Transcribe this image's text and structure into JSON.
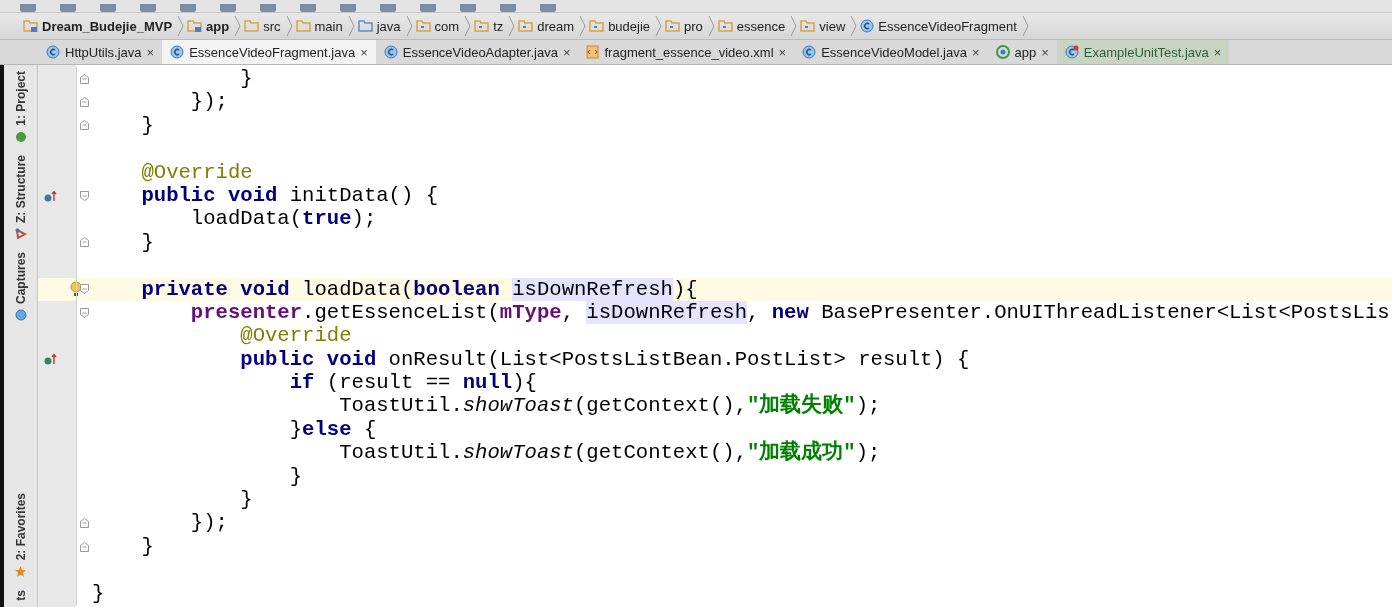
{
  "breadcrumbs": [
    {
      "label": "Dream_Budejie_MVP",
      "kind": "module"
    },
    {
      "label": "app",
      "kind": "module"
    },
    {
      "label": "src",
      "kind": "folder"
    },
    {
      "label": "main",
      "kind": "folder"
    },
    {
      "label": "java",
      "kind": "source"
    },
    {
      "label": "com",
      "kind": "package"
    },
    {
      "label": "tz",
      "kind": "package"
    },
    {
      "label": "dream",
      "kind": "package"
    },
    {
      "label": "budejie",
      "kind": "package"
    },
    {
      "label": "pro",
      "kind": "package"
    },
    {
      "label": "essence",
      "kind": "package"
    },
    {
      "label": "view",
      "kind": "package"
    },
    {
      "label": "EssenceVideoFragment",
      "kind": "class"
    }
  ],
  "tabs": [
    {
      "label": "HttpUtils.java",
      "kind": "class",
      "selected": false,
      "close": "×"
    },
    {
      "label": "EssenceVideoFragment.java",
      "kind": "class",
      "selected": true,
      "close": "×"
    },
    {
      "label": "EssenceVideoAdapter.java",
      "kind": "class",
      "selected": false,
      "close": "×"
    },
    {
      "label": "fragment_essence_video.xml",
      "kind": "xml",
      "selected": false,
      "close": "×"
    },
    {
      "label": "EssenceVideoModel.java",
      "kind": "class",
      "selected": false,
      "close": "×"
    },
    {
      "label": "app",
      "kind": "module",
      "selected": false,
      "close": "×"
    },
    {
      "label": "ExampleUnitTest.java",
      "kind": "test",
      "selected": false,
      "close": "×"
    }
  ],
  "tool_windows": [
    {
      "label": "1: Project",
      "kind": "project"
    },
    {
      "label": "Z: Structure",
      "kind": "structure"
    },
    {
      "label": "Captures",
      "kind": "captures"
    },
    {
      "label": "2: Favorites",
      "kind": "favorites"
    },
    {
      "label": "ts",
      "kind": "none"
    }
  ],
  "editor": {
    "lines": [
      {
        "kind": "code",
        "fold": {
          "kind": "end"
        },
        "segments": [
          {
            "kind": "plain",
            "text": "            }"
          }
        ]
      },
      {
        "kind": "code",
        "fold": {
          "kind": "end"
        },
        "segments": [
          {
            "kind": "plain",
            "text": "        });"
          }
        ]
      },
      {
        "kind": "code",
        "fold": {
          "kind": "end"
        },
        "segments": [
          {
            "kind": "plain",
            "text": "    }"
          }
        ]
      },
      {
        "kind": "blank"
      },
      {
        "kind": "code",
        "segments": [
          {
            "kind": "annotation",
            "text": "    @Override"
          }
        ]
      },
      {
        "kind": "code",
        "fold": {
          "kind": "start"
        },
        "gutter": {
          "kind": "overrides"
        },
        "segments": [
          {
            "kind": "keyword",
            "text": "    public void "
          },
          {
            "kind": "plain",
            "text": "initData() {"
          }
        ]
      },
      {
        "kind": "code",
        "segments": [
          {
            "kind": "plain",
            "text": "        loadData("
          },
          {
            "kind": "keyword",
            "text": "true"
          },
          {
            "kind": "plain",
            "text": ");"
          }
        ]
      },
      {
        "kind": "code",
        "fold": {
          "kind": "end"
        },
        "segments": [
          {
            "kind": "plain",
            "text": "    }"
          }
        ]
      },
      {
        "kind": "blank"
      },
      {
        "kind": "code",
        "fold": {
          "kind": "start"
        },
        "gutter": {
          "kind": "bulb"
        },
        "current": true,
        "segments": [
          {
            "kind": "keyword",
            "text": "    private void "
          },
          {
            "kind": "plain",
            "text": "loadData("
          },
          {
            "kind": "keyword",
            "text": "boolean "
          },
          {
            "kind": "param",
            "text": "isDownRefresh"
          },
          {
            "kind": "plain",
            "text": "){"
          }
        ]
      },
      {
        "kind": "code",
        "fold": {
          "kind": "start"
        },
        "segments": [
          {
            "kind": "field",
            "text": "        presenter"
          },
          {
            "kind": "plain",
            "text": ".getEssenceList("
          },
          {
            "kind": "field",
            "text": "mType"
          },
          {
            "kind": "plain",
            "text": ", "
          },
          {
            "kind": "param",
            "text": "isDownRefresh"
          },
          {
            "kind": "plain",
            "text": ", "
          },
          {
            "kind": "keyword",
            "text": "new "
          },
          {
            "kind": "plain",
            "text": "BasePresenter.OnUIThreadListener<List<PostsLis"
          }
        ]
      },
      {
        "kind": "code",
        "segments": [
          {
            "kind": "annotation",
            "text": "            @Override"
          }
        ]
      },
      {
        "kind": "code",
        "gutter": {
          "kind": "implements"
        },
        "segments": [
          {
            "kind": "keyword",
            "text": "            public void "
          },
          {
            "kind": "plain",
            "text": "onResult(List<PostsListBean.PostList> result) {"
          }
        ]
      },
      {
        "kind": "code",
        "segments": [
          {
            "kind": "keyword",
            "text": "                if "
          },
          {
            "kind": "plain",
            "text": "(result == "
          },
          {
            "kind": "keyword",
            "text": "null"
          },
          {
            "kind": "plain",
            "text": "){"
          }
        ]
      },
      {
        "kind": "code",
        "segments": [
          {
            "kind": "plain",
            "text": "                    ToastUtil."
          },
          {
            "kind": "static",
            "text": "showToast"
          },
          {
            "kind": "plain",
            "text": "(getContext(),"
          },
          {
            "kind": "string",
            "text": "\"加载失败\""
          },
          {
            "kind": "plain",
            "text": ");"
          }
        ]
      },
      {
        "kind": "code",
        "segments": [
          {
            "kind": "plain",
            "text": "                }"
          },
          {
            "kind": "keyword",
            "text": "else "
          },
          {
            "kind": "plain",
            "text": "{"
          }
        ]
      },
      {
        "kind": "code",
        "segments": [
          {
            "kind": "plain",
            "text": "                    ToastUtil."
          },
          {
            "kind": "static",
            "text": "showToast"
          },
          {
            "kind": "plain",
            "text": "(getContext(),"
          },
          {
            "kind": "string",
            "text": "\"加载成功\""
          },
          {
            "kind": "plain",
            "text": ");"
          }
        ]
      },
      {
        "kind": "code",
        "segments": [
          {
            "kind": "plain",
            "text": "                }"
          }
        ]
      },
      {
        "kind": "code",
        "segments": [
          {
            "kind": "plain",
            "text": "            }"
          }
        ]
      },
      {
        "kind": "code",
        "fold": {
          "kind": "end"
        },
        "segments": [
          {
            "kind": "plain",
            "text": "        });"
          }
        ]
      },
      {
        "kind": "code",
        "fold": {
          "kind": "end"
        },
        "segments": [
          {
            "kind": "plain",
            "text": "    }"
          }
        ]
      },
      {
        "kind": "blank"
      },
      {
        "kind": "code",
        "segments": [
          {
            "kind": "plain",
            "text": "}"
          }
        ]
      }
    ]
  }
}
